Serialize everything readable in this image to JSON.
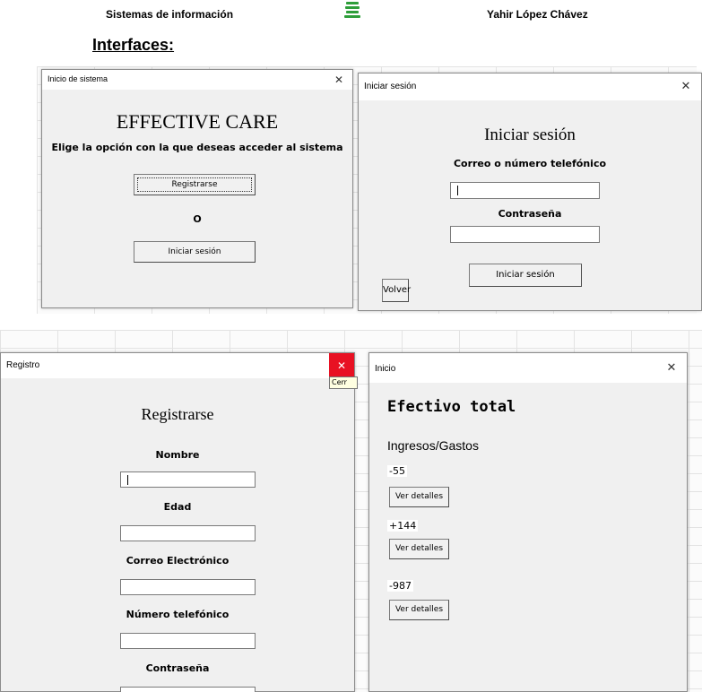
{
  "doc": {
    "left_header": "Sistemas de información",
    "right_header": "Yahir López Chávez",
    "section_title": "Interfaces:"
  },
  "login_window": {
    "title": "Inicio de sistema",
    "close": "✕",
    "heading": "EFFECTIVE CARE",
    "subtitle": "Elige la opción con la que deseas acceder al sistema",
    "register_label": "Registrarse",
    "or_label": "O",
    "login_label": "Iniciar sesión"
  },
  "signin_window": {
    "title": "Iniciar sesión",
    "close": "✕",
    "heading": "Iniciar sesión",
    "email_label": "Correo o número telefónico",
    "email_value": "",
    "password_label": "Contraseña",
    "password_value": "",
    "submit_label": "Iniciar sesión",
    "back_label": "Volver"
  },
  "register_window": {
    "title": "Registro",
    "close": "✕",
    "close_tooltip": "Cerr",
    "heading": "Registrarse",
    "fields": [
      {
        "label": "Nombre",
        "value": ""
      },
      {
        "label": "Edad",
        "value": ""
      },
      {
        "label": "Correo Electrónico",
        "value": ""
      },
      {
        "label": "Número telefónico",
        "value": ""
      },
      {
        "label": "Contraseña",
        "value": ""
      }
    ]
  },
  "home_window": {
    "title": "Inicio",
    "close": "✕",
    "heading": "Efectivo total",
    "subheading": "Ingresos/Gastos",
    "entries": [
      {
        "value": "-55",
        "button": "Ver detalles"
      },
      {
        "value": "+144",
        "button": "Ver detalles"
      },
      {
        "value": "-987",
        "button": "Ver detalles"
      }
    ]
  },
  "colors": {
    "window_bg": "#f0f0f0",
    "titlebar_bg": "#ffffff",
    "close_hover_red": "#e81123",
    "logo_green": "#2e9e3a"
  }
}
